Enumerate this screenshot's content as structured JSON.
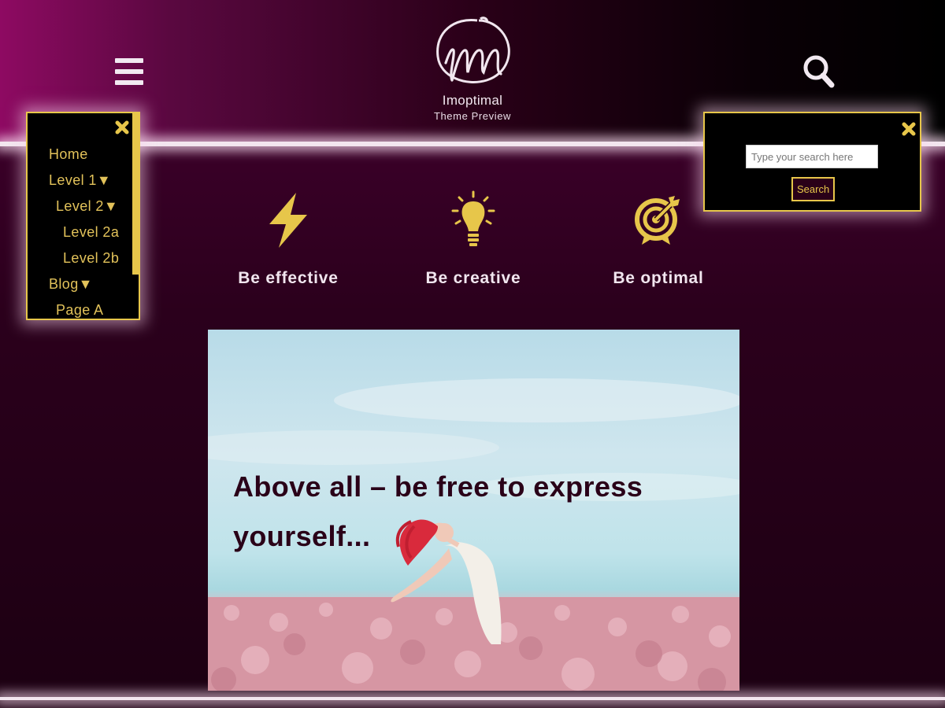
{
  "brand": {
    "name": "Imoptimal",
    "tagline": "Theme Preview"
  },
  "header": {
    "menu_icon": "hamburger-menu-icon",
    "search_icon": "search-icon"
  },
  "nav": {
    "close_icon": "close-icon",
    "items": [
      {
        "label": "Home"
      },
      {
        "label": "Level 1▼"
      },
      {
        "label": "Level 2▼"
      },
      {
        "label": "Level 2a"
      },
      {
        "label": "Level 2b"
      },
      {
        "label": "Blog▼"
      },
      {
        "label": "Page A"
      }
    ]
  },
  "search": {
    "placeholder": "Type your search here",
    "button_label": "Search",
    "close_icon": "close-icon"
  },
  "features": [
    {
      "label": "Be effective",
      "icon": "lightning-bolt-icon"
    },
    {
      "label": "Be creative",
      "icon": "lightbulb-icon"
    },
    {
      "label": "Be optimal",
      "icon": "target-icon"
    }
  ],
  "hero": {
    "text": "Above all – be free to express yourself...",
    "image": "woman-in-flower-field-image"
  },
  "colors": {
    "accent": "#e7c64a",
    "background": "#2a0018",
    "header_magenta": "#8e0a62",
    "text_light": "#f1e6ef"
  }
}
